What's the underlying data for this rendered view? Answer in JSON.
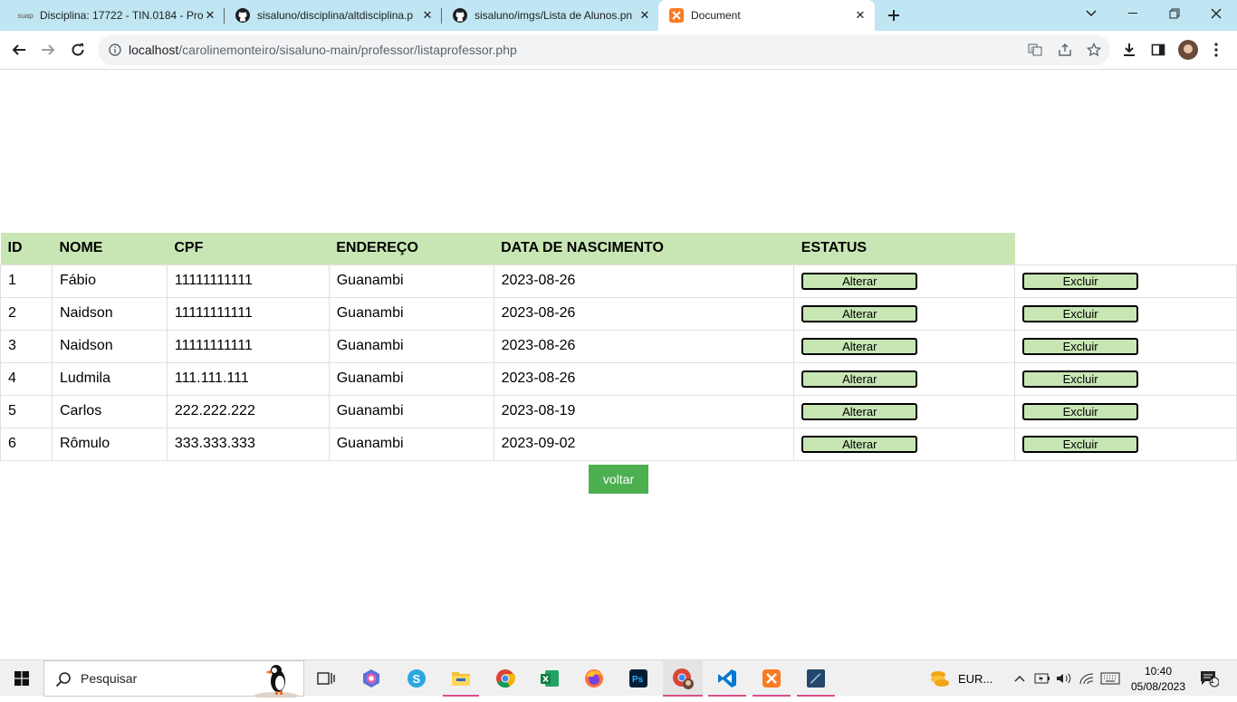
{
  "browser": {
    "tabs": [
      {
        "favicon": "suap",
        "title": "Disciplina: 17722 - TIN.0184 - Pro",
        "active": false
      },
      {
        "favicon": "github-icon",
        "title": "sisaluno/disciplina/altdisciplina.p",
        "active": false
      },
      {
        "favicon": "github-icon",
        "title": "sisaluno/imgs/Lista de Alunos.pn",
        "active": false
      },
      {
        "favicon": "xampp-icon",
        "title": "Document",
        "active": true
      }
    ],
    "url_host": "localhost",
    "url_path": "/carolinemonteiro/sisaluno-main/professor/listaprofessor.php"
  },
  "page": {
    "headers": [
      "ID",
      "NOME",
      "CPF",
      "ENDEREÇO",
      "DATA DE NASCIMENTO",
      "ESTATUS"
    ],
    "rows": [
      {
        "id": "1",
        "nome": "Fábio",
        "cpf": "11111111111",
        "endereco": "Guanambi",
        "data": "2023-08-26"
      },
      {
        "id": "2",
        "nome": "Naidson",
        "cpf": "11111111111",
        "endereco": "Guanambi",
        "data": "2023-08-26"
      },
      {
        "id": "3",
        "nome": "Naidson",
        "cpf": "11111111111",
        "endereco": "Guanambi",
        "data": "2023-08-26"
      },
      {
        "id": "4",
        "nome": "Ludmila",
        "cpf": "111.111.111",
        "endereco": "Guanambi",
        "data": "2023-08-26"
      },
      {
        "id": "5",
        "nome": "Carlos",
        "cpf": "222.222.222",
        "endereco": "Guanambi",
        "data": "2023-08-19"
      },
      {
        "id": "6",
        "nome": "Rômulo",
        "cpf": "333.333.333",
        "endereco": "Guanambi",
        "data": "2023-09-02"
      }
    ],
    "alterar_label": "Alterar",
    "excluir_label": "Excluir",
    "voltar_label": "voltar"
  },
  "taskbar": {
    "search_placeholder": "Pesquisar",
    "weather_text": "EUR...",
    "time": "10:40",
    "date": "05/08/2023",
    "notification_count": "1"
  },
  "colors": {
    "table_header_bg": "#c8e6b4",
    "voltar_bg": "#4caf50",
    "tabstrip_bg": "#bfe6f2"
  }
}
